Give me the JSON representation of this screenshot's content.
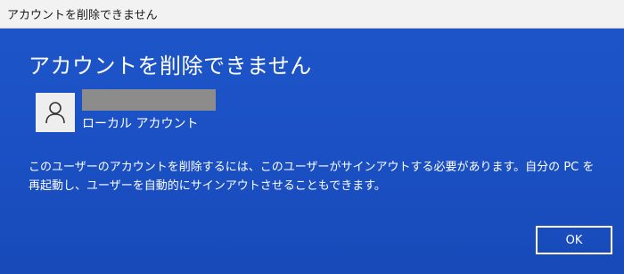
{
  "window": {
    "title": "アカウントを削除できません"
  },
  "dialog": {
    "heading": "アカウントを削除できません",
    "account": {
      "avatar_icon": "user-icon",
      "type_label": "ローカル アカウント"
    },
    "message": "このユーザーのアカウントを削除するには、このユーザーがサインアウトする必要があります。自分の PC を再起動し、ユーザーを自動的にサインアウトさせることもできます。",
    "ok_label": "OK"
  },
  "colors": {
    "background": "#1a4fc2",
    "titlebar": "#f2f2f2",
    "text": "#ffffff",
    "redaction": "#8c8c8c"
  }
}
